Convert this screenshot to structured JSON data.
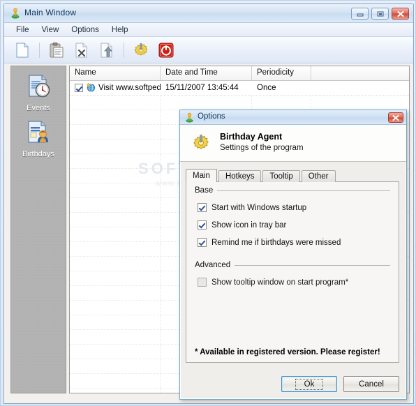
{
  "window": {
    "title": "Main Window",
    "icon": "user-figure-icon",
    "controls": [
      {
        "name": "minimize",
        "glyph": "minimize-icon"
      },
      {
        "name": "maximize",
        "glyph": "maximize-icon"
      },
      {
        "name": "close",
        "glyph": "close-icon"
      }
    ]
  },
  "menu": {
    "items": [
      {
        "label": "File"
      },
      {
        "label": "View"
      },
      {
        "label": "Options"
      },
      {
        "label": "Help"
      }
    ]
  },
  "toolbar": {
    "buttons": [
      {
        "name": "new-document-button",
        "icon": "new-document-icon",
        "tooltip": "New"
      },
      {
        "name": "paste-button",
        "icon": "clipboard-paste-icon",
        "tooltip": "Paste"
      },
      {
        "name": "delete-button",
        "icon": "delete-document-icon",
        "tooltip": "Delete"
      },
      {
        "name": "export-button",
        "icon": "export-document-icon",
        "tooltip": "Export"
      },
      {
        "name": "options-button",
        "icon": "gear-icon",
        "tooltip": "Options"
      },
      {
        "name": "exit-button",
        "icon": "power-off-icon",
        "tooltip": "Exit"
      }
    ]
  },
  "sidebar": {
    "items": [
      {
        "label": "Events",
        "icon": "document-clock-icon"
      },
      {
        "label": "Birthdays",
        "icon": "document-person-icon"
      }
    ]
  },
  "listview": {
    "columns": [
      "Name",
      "Date and Time",
      "Periodicity",
      ""
    ],
    "rows": [
      {
        "checked": true,
        "icon": "globe-star-icon",
        "name": "Visit www.softpedia.com",
        "datetime": "15/11/2007 13:45:44",
        "periodicity": "Once"
      }
    ]
  },
  "watermark": {
    "line1": "SOFTPEDIA",
    "line2": "www.softpedia.com"
  },
  "dialog": {
    "title": "Options",
    "title_icon": "user-figure-icon",
    "close_glyph": "close-icon",
    "header": {
      "icon": "gear-icon",
      "title": "Birthday Agent",
      "subtitle": "Settings of the program"
    },
    "tabs": [
      {
        "label": "Main",
        "active": true
      },
      {
        "label": "Hotkeys",
        "active": false
      },
      {
        "label": "Tooltip",
        "active": false
      },
      {
        "label": "Other",
        "active": false
      }
    ],
    "groups": [
      {
        "label": "Base",
        "options": [
          {
            "label": "Start with Windows startup",
            "checked": true,
            "disabled": false
          },
          {
            "label": "Show icon in tray bar",
            "checked": true,
            "disabled": false
          },
          {
            "label": "Remind me if birthdays were missed",
            "checked": true,
            "disabled": false
          }
        ]
      },
      {
        "label": "Advanced",
        "options": [
          {
            "label": "Show tooltip window on start program*",
            "checked": false,
            "disabled": true
          }
        ]
      }
    ],
    "note": "* Available in registered version. Please register!",
    "buttons": [
      {
        "label": "Ok",
        "default": true
      },
      {
        "label": "Cancel",
        "default": false
      }
    ]
  },
  "colors": {
    "titlebar_blue": "#d2e2f3",
    "sidebar_gray": "#b2b2b2",
    "dialog_border": "#6fa8c8",
    "close_red": "#cf4833",
    "default_button_border": "#3c93c8"
  }
}
